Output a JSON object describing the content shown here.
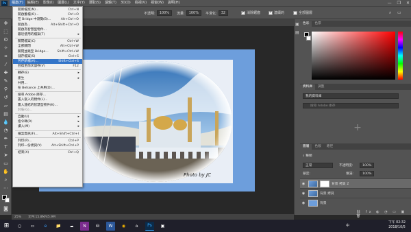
{
  "menubar": {
    "app_logo": "Ps",
    "items": [
      "檔案(F)",
      "編輯(E)",
      "影像(I)",
      "圖層(L)",
      "文字(Y)",
      "選取(S)",
      "濾鏡(T)",
      "3D(D)",
      "檢視(V)",
      "視窗(W)",
      "說明(H)"
    ],
    "active_index": 0
  },
  "window_controls": {
    "minimize": "—",
    "restore": "❐",
    "close": "✕"
  },
  "options_bar": {
    "opacity_label": "不透明:",
    "opacity_value": "100%",
    "flow_label": "流量:",
    "flow_value": "100%",
    "smoothing_label": "平滑化:",
    "smoothing_value": "32",
    "checkbox1_label": "消除鋸齒",
    "checkbox2_label": "連續的",
    "checkbox3_label": "全部圖層"
  },
  "file_menu": {
    "items": [
      {
        "label": "開新檔案(N)...",
        "shortcut": "Ctrl+N",
        "disabled": false
      },
      {
        "label": "開啟舊檔(O)...",
        "shortcut": "Ctrl+O",
        "disabled": false
      },
      {
        "label": "在 Bridge 中瀏覽(B)...",
        "shortcut": "Alt+Ctrl+O",
        "disabled": false
      },
      {
        "label": "開啟為...",
        "shortcut": "Alt+Shift+Ctrl+O",
        "disabled": false
      },
      {
        "label": "開啟為智慧型物件...",
        "shortcut": "",
        "disabled": false
      },
      {
        "label": "最近使用的檔案(T)",
        "shortcut": "",
        "disabled": false,
        "submenu": true
      },
      {
        "sep": true
      },
      {
        "label": "關閉檔案(C)",
        "shortcut": "Ctrl+W",
        "disabled": false
      },
      {
        "label": "全部關閉",
        "shortcut": "Alt+Ctrl+W",
        "disabled": false
      },
      {
        "label": "關閉並跳至 Bridge...",
        "shortcut": "Shift+Ctrl+W",
        "disabled": false
      },
      {
        "label": "儲存檔案(S)",
        "shortcut": "Ctrl+S",
        "disabled": false
      },
      {
        "label": "另存新檔(A)...",
        "shortcut": "Shift+Ctrl+S",
        "disabled": false,
        "highlighted": true
      },
      {
        "label": "回復至前次儲存(V)",
        "shortcut": "F12",
        "disabled": false
      },
      {
        "sep": true
      },
      {
        "label": "轉存(E)",
        "shortcut": "",
        "disabled": false,
        "submenu": true
      },
      {
        "label": "產生",
        "shortcut": "",
        "disabled": false,
        "submenu": true
      },
      {
        "label": "共用...",
        "shortcut": "",
        "disabled": false
      },
      {
        "label": "在 Behance 上共用(D)...",
        "shortcut": "",
        "disabled": false
      },
      {
        "sep": true
      },
      {
        "label": "搜尋 Adobe 庫存...",
        "shortcut": "",
        "disabled": false
      },
      {
        "label": "置入嵌入的物件(L)...",
        "shortcut": "",
        "disabled": false
      },
      {
        "label": "置入連結的智慧型物件(K)...",
        "shortcut": "",
        "disabled": false
      },
      {
        "label": "封裝(G)...",
        "shortcut": "",
        "disabled": true
      },
      {
        "sep": true
      },
      {
        "label": "自動(U)",
        "shortcut": "",
        "disabled": false,
        "submenu": true
      },
      {
        "label": "指令碼(R)",
        "shortcut": "",
        "disabled": false,
        "submenu": true
      },
      {
        "label": "讀入(M)",
        "shortcut": "",
        "disabled": false,
        "submenu": true
      },
      {
        "sep": true
      },
      {
        "label": "檔案資訊(F)...",
        "shortcut": "Alt+Shift+Ctrl+I",
        "disabled": false
      },
      {
        "sep": true
      },
      {
        "label": "列印(P)...",
        "shortcut": "Ctrl+P",
        "disabled": false
      },
      {
        "label": "列印一份拷貝(Y)",
        "shortcut": "Alt+Shift+Ctrl+P",
        "disabled": false
      },
      {
        "sep": true
      },
      {
        "label": "結束(X)",
        "shortcut": "Ctrl+Q",
        "disabled": false
      }
    ]
  },
  "status_bar": {
    "zoom": "25%",
    "doc_info": "文件:15.8M/45.9M"
  },
  "photo": {
    "watermark": "Photo by JC"
  },
  "color_panel": {
    "tabs": [
      "色彩",
      "色票"
    ]
  },
  "libraries_panel": {
    "tabs": [
      "資料庫",
      "調整"
    ],
    "library_name": "我的資料庫",
    "search_placeholder": "搜尋 Adobe 庫存"
  },
  "layers_panel": {
    "tabs": [
      "圖層",
      "色版",
      "路徑"
    ],
    "kind_label": "種類",
    "blend_mode": "正常",
    "opacity_label": "不透明度:",
    "opacity_value": "100%",
    "lock_label": "鎖定:",
    "fill_label": "填滿:",
    "fill_value": "100%",
    "layers": [
      {
        "name": "背景 拷貝 2",
        "selected": true
      },
      {
        "name": "背景 拷貝",
        "selected": false
      },
      {
        "name": "背景",
        "selected": false
      }
    ]
  },
  "taskbar": {
    "start_label": "⊞",
    "icons": [
      "○",
      "▭",
      "e",
      "📁",
      "☁",
      "N",
      "⛁",
      "W",
      "◉",
      "⌂",
      "Ps",
      "▣"
    ],
    "tray_lang": "中",
    "time": "下午 02:32",
    "date": "2018/10/5"
  },
  "colors": {
    "app_bg": "#282828",
    "panel_bg": "#535353",
    "canvas_blue": "#6d9edc",
    "highlight": "#3374c8"
  }
}
